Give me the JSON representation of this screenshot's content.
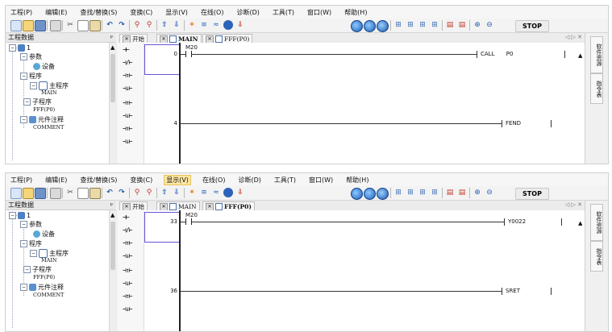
{
  "menu": [
    "工程(P)",
    "编辑(E)",
    "查找/替换(S)",
    "变换(C)",
    "显示(V)",
    "在线(O)",
    "诊断(D)",
    "工具(T)",
    "窗口(W)",
    "帮助(H)"
  ],
  "toolbar": {
    "stop_label": "STOP"
  },
  "project_panel": {
    "title": "工程数据",
    "pin": "ᵖ",
    "items": {
      "root": "1",
      "params": "参数",
      "device": "设备",
      "program": "程序",
      "main_program": "主程序",
      "main_name": "MAIN",
      "sub_program": "子程序",
      "sub_name": "FFF(P0)",
      "comment_group": "元件注释",
      "comment_name": "COMMENT"
    }
  },
  "tabs": {
    "start": "开始",
    "main": "MAIN",
    "sub": "FFF(P0)",
    "controls": "◁ ▷ ✕"
  },
  "palette": [
    "⊣⊢",
    "⊣/⊢",
    "⊣↑⊢",
    "⊣↓⊢",
    "⊣↑⊢",
    "⊣↓⊢",
    "⊣↑⊢",
    "⊣↓⊢"
  ],
  "right_tabs": [
    "软件资源",
    "指令表"
  ],
  "screens": [
    {
      "rung1": {
        "number": "0",
        "contact": "M20",
        "instruction": "CALL",
        "argument": "P0"
      },
      "rung2": {
        "number": "4",
        "instruction": "FEND"
      }
    },
    {
      "rung1": {
        "number": "33",
        "contact": "M20",
        "instruction": "Y0022"
      },
      "rung2": {
        "number": "36",
        "instruction": "SRET"
      }
    }
  ]
}
